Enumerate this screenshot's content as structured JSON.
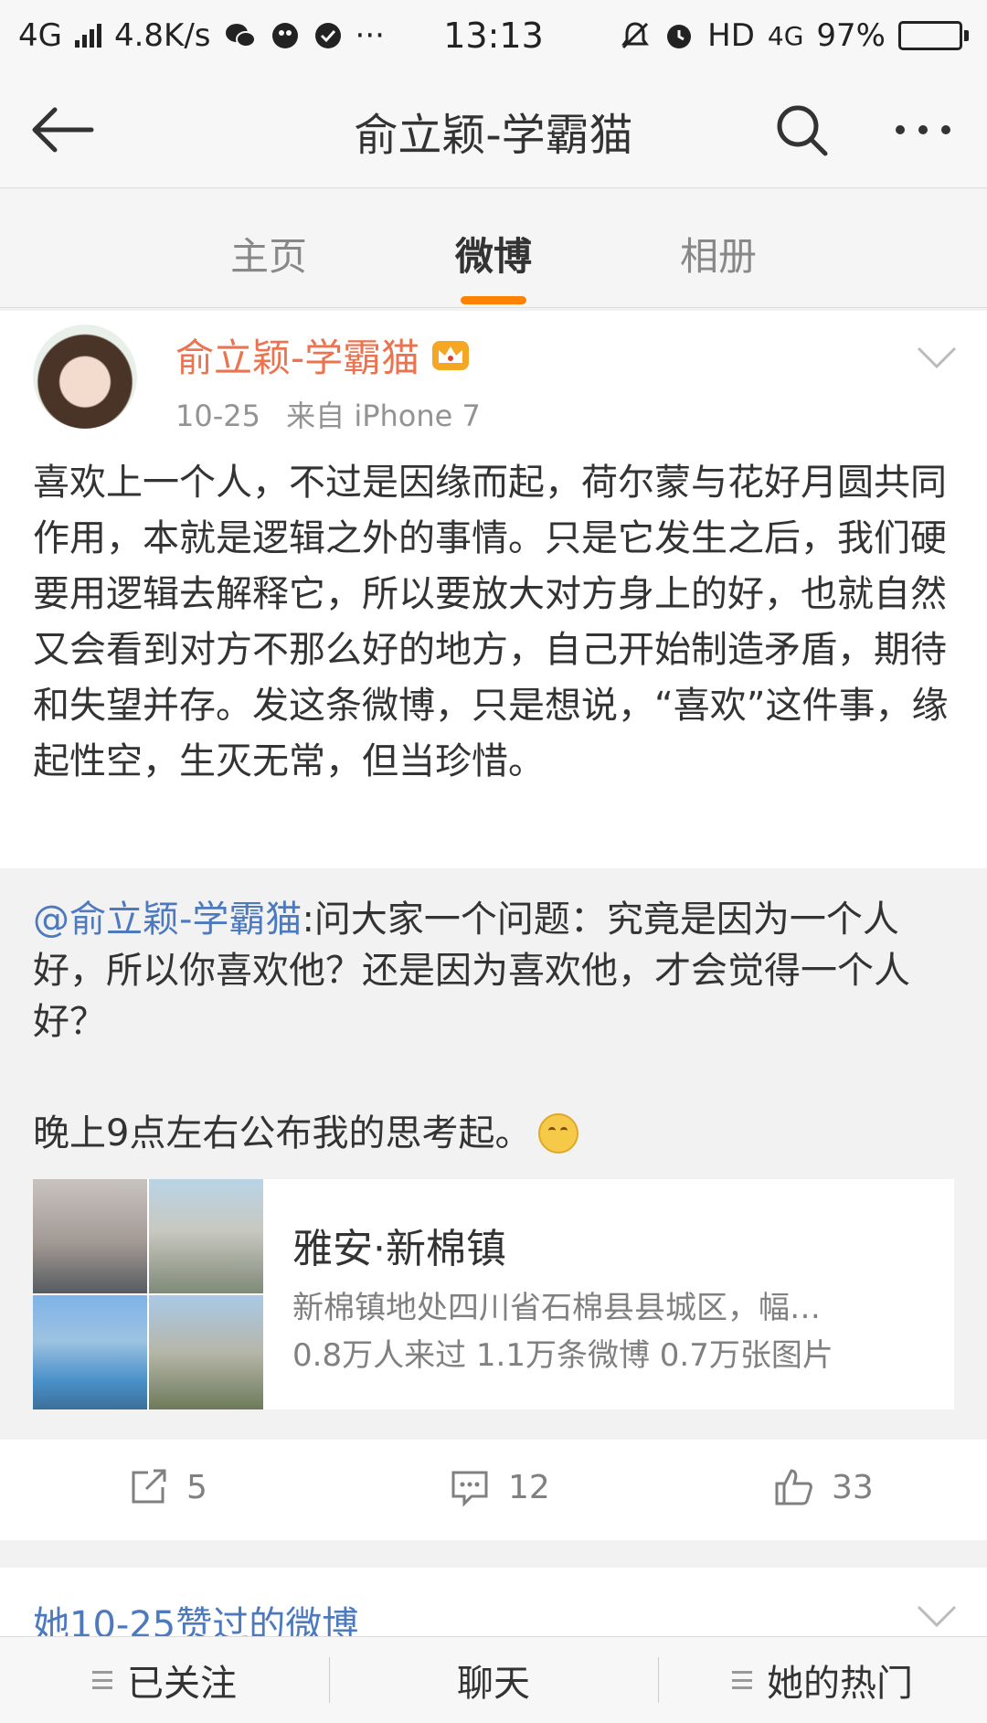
{
  "status_bar": {
    "network": "4G",
    "speed": "4.8K/s",
    "time": "13:13",
    "hd": "HD",
    "network_right": "4G",
    "battery_pct": "97%",
    "battery_level": 0.97
  },
  "nav": {
    "title": "俞立颖-学霸猫",
    "icons": [
      "back-arrow-icon",
      "search-icon",
      "more-icon"
    ]
  },
  "tabs": [
    "主页",
    "微博",
    "相册"
  ],
  "tabs_active": 1,
  "post": {
    "author": "俞立颖-学霸猫",
    "date": "10-25",
    "source": "来自 iPhone 7",
    "text": "喜欢上一个人，不过是因缘而起，荷尔蒙与花好月圆共同作用，本就是逻辑之外的事情。只是它发生之后，我们硬要用逻辑去解释它，所以要放大对方身上的好，也就自然又会看到对方不那么好的地方，自己开始制造矛盾，期待和失望并存。发这条微博，只是想说，“喜欢”这件事，缘起性空，生灭无常，但当珍惜。",
    "repost": {
      "mention": "@俞立颖-学霸猫",
      "text": ":问大家一个问题：究竟是因为一个人好，所以你喜欢他？还是因为喜欢他，才会觉得一个人好？",
      "text2": "晚上9点左右公布我的思考起。"
    },
    "place": {
      "name": "雅安·新棉镇",
      "desc": "新棉镇地处四川省石棉县县城区，幅…",
      "stats": "0.8万人来过 1.1万条微博 0.7万张图片"
    },
    "actions": {
      "repost_count": "5",
      "comment_count": "12",
      "like_count": "33"
    }
  },
  "liked": {
    "label": "她10-25赞过的微博"
  },
  "bottom_bar": {
    "follow": "已关注",
    "chat": "聊天",
    "hot": "她的热门"
  },
  "colors": {
    "accent": "#ff8200",
    "author": "#eb7350",
    "link": "#4d7abe"
  }
}
